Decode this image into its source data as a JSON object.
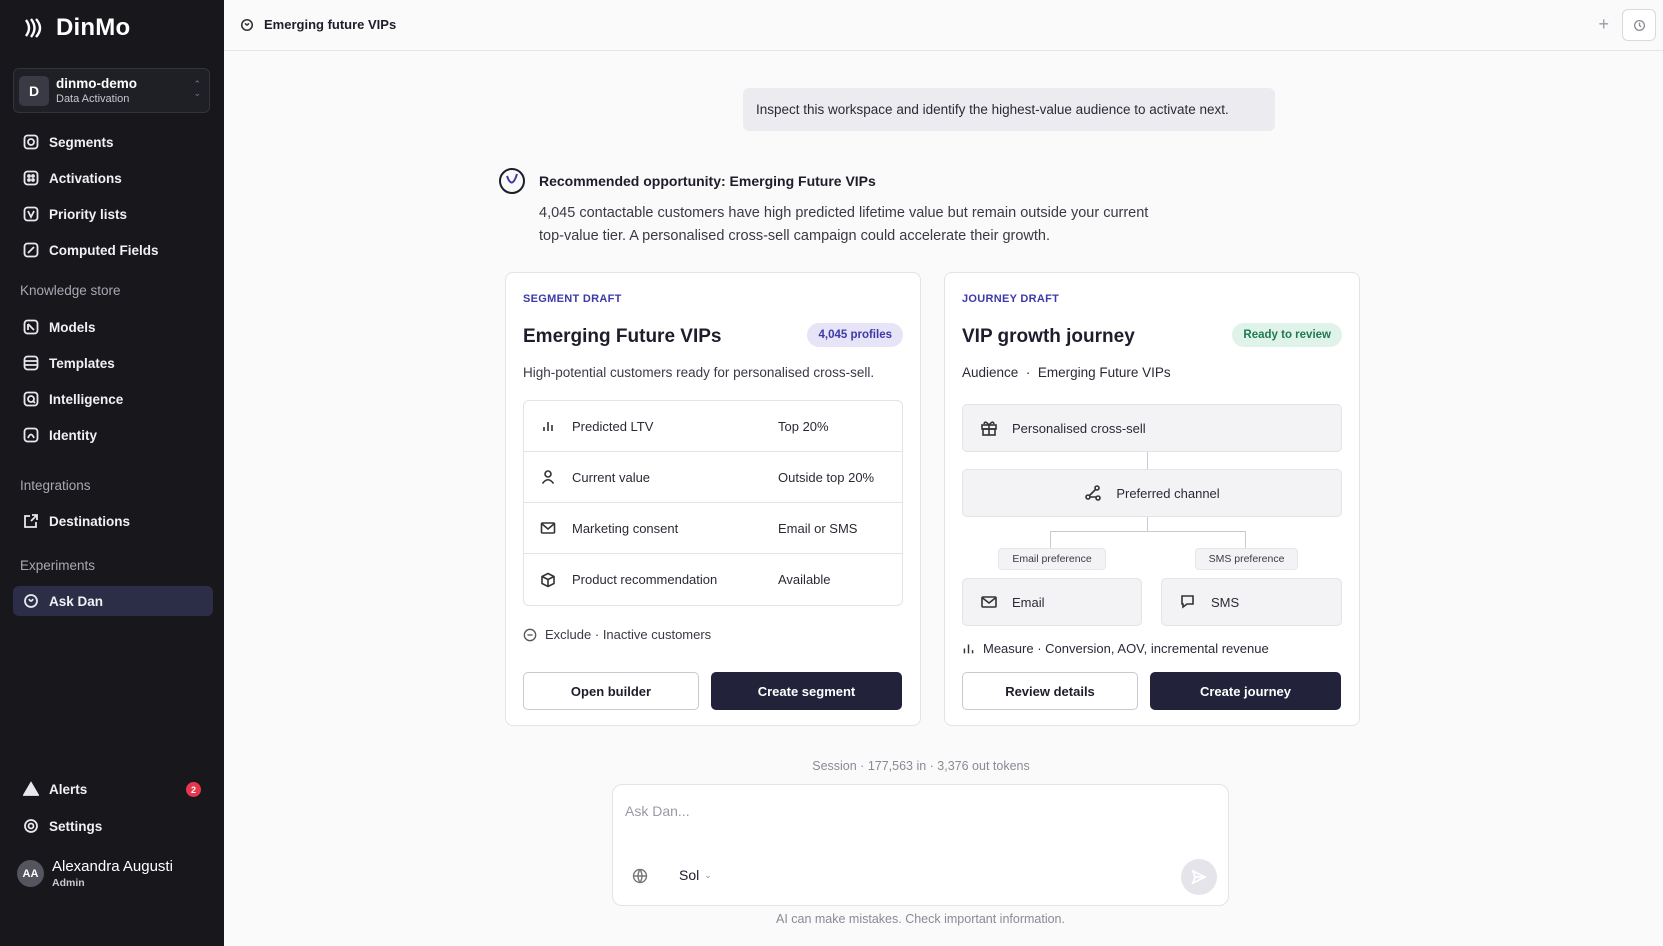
{
  "sidebar": {
    "brand": "DinMo",
    "workspace": {
      "initial": "D",
      "name": "dinmo-demo",
      "subtitle": "Data Activation"
    },
    "items": [
      {
        "label": "Segments",
        "icon": "segments-icon"
      },
      {
        "label": "Activations",
        "icon": "activations-icon"
      },
      {
        "label": "Priority lists",
        "icon": "priority-lists-icon"
      },
      {
        "label": "Computed Fields",
        "icon": "computed-fields-icon"
      }
    ],
    "knowledge_section": "Knowledge store",
    "knowledge_items": [
      {
        "label": "Models",
        "icon": "models-icon"
      },
      {
        "label": "Templates",
        "icon": "templates-icon"
      },
      {
        "label": "Intelligence",
        "icon": "intelligence-icon"
      },
      {
        "label": "Identity",
        "icon": "identity-icon"
      }
    ],
    "integrations_section": "Integrations",
    "integrations_items": [
      {
        "label": "Destinations",
        "icon": "destinations-icon"
      }
    ],
    "experiments_section": "Experiments",
    "experiments_items": [
      {
        "label": "Ask Dan",
        "icon": "ask-dan-icon",
        "active": true
      }
    ],
    "alerts": {
      "label": "Alerts",
      "count": "2"
    },
    "settings": {
      "label": "Settings"
    },
    "user": {
      "initials": "AA",
      "name": "Alexandra Augusti",
      "role": "Admin"
    }
  },
  "topbar": {
    "title": "Emerging future VIPs"
  },
  "chat": {
    "user_prompt": "Inspect this workspace and identify the highest-value audience to activate next.",
    "rec_title": "Recommended opportunity: Emerging Future VIPs",
    "rec_body_line1": "4,045 contactable customers have high predicted lifetime value but remain outside your current",
    "rec_body_line2": "top-value tier. A personalised cross-sell campaign could accelerate their growth."
  },
  "segment_card": {
    "eyebrow": "SEGMENT DRAFT",
    "title": "Emerging Future VIPs",
    "badge": "4,045 profiles",
    "description": "High-potential customers ready for personalised cross-sell.",
    "criteria": [
      {
        "label": "Predicted LTV",
        "value": "Top 20%",
        "icon": "bar-chart-icon"
      },
      {
        "label": "Current value",
        "value": "Outside top 20%",
        "icon": "person-icon"
      },
      {
        "label": "Marketing consent",
        "value": "Email or SMS",
        "icon": "mail-icon"
      },
      {
        "label": "Product recommendation",
        "value": "Available",
        "icon": "box-icon"
      }
    ],
    "exclude_label": "Exclude",
    "exclude_value": "Inactive customers",
    "secondary_button": "Open builder",
    "primary_button": "Create segment"
  },
  "journey_card": {
    "eyebrow": "JOURNEY DRAFT",
    "title": "VIP growth journey",
    "badge": "Ready to review",
    "audience_label": "Audience",
    "audience_value": "Emerging Future VIPs",
    "step_1": "Personalised cross-sell",
    "step_2": "Preferred channel",
    "branch_email_tag": "Email preference",
    "branch_sms_tag": "SMS preference",
    "branch_email": "Email",
    "branch_sms": "SMS",
    "measure_label": "Measure",
    "measure_value": "Conversion, AOV, incremental revenue",
    "secondary_button": "Review details",
    "primary_button": "Create journey"
  },
  "session": "Session · 177,563 in · 3,376 out tokens",
  "composer": {
    "placeholder": "Ask Dan...",
    "model": "Sol"
  },
  "disclaimer": "AI can make mistakes. Check important information.",
  "colors": {
    "sidebar_bg": "#17171c",
    "accent": "#3d3aa8",
    "primary_button": "#22223a",
    "ready_green": "#1f7a52",
    "alert_red": "#e5384f"
  }
}
